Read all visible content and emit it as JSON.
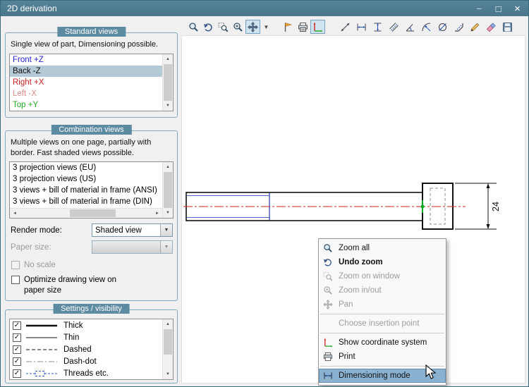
{
  "window": {
    "title": "2D derivation"
  },
  "standard_views": {
    "title": "Standard views",
    "description": "Single view of part, Dimensioning possible.",
    "items": [
      {
        "label": "Front +Z",
        "color": "#2222cc",
        "selected": false
      },
      {
        "label": "Back -Z",
        "color": "#111111",
        "selected": true
      },
      {
        "label": "Right +X",
        "color": "#cc2222",
        "selected": false
      },
      {
        "label": "Left -X",
        "color": "#dd8888",
        "selected": false
      },
      {
        "label": "Top +Y",
        "color": "#22aa22",
        "selected": false
      }
    ]
  },
  "combination_views": {
    "title": "Combination views",
    "description": "Multiple views on one page, partially with border. Fast shaded views possible.",
    "items": [
      "3 projection views (EU)",
      "3 projection views (US)",
      "3 views + bill of material in frame (ANSI)",
      "3 views + bill of material in frame (DIN)"
    ],
    "render_mode_label": "Render mode:",
    "render_mode_value": "Shaded view",
    "paper_size_label": "Paper size:",
    "no_scale_label": "No scale",
    "optimize_label": "Optimize drawing view on paper size"
  },
  "settings": {
    "title": "Settings / visibility",
    "items": [
      {
        "label": "Thick",
        "checked": true
      },
      {
        "label": "Thin",
        "checked": true
      },
      {
        "label": "Dashed",
        "checked": true
      },
      {
        "label": "Dash-dot",
        "checked": true
      },
      {
        "label": "Threads etc.",
        "checked": true
      }
    ]
  },
  "toolbar": {
    "view_tools": [
      "zoom-all",
      "undo-zoom",
      "zoom-on-window",
      "zoom-in-out",
      "pan",
      "view-options-dropdown",
      "choose-insertion-point",
      "print",
      "show-coordinate-system"
    ],
    "active_tools": [
      "pan",
      "show-coordinate-system"
    ],
    "dimension_tools": [
      "smart-dimension",
      "horizontal-dimension",
      "vertical-dimension",
      "parallel-dimension",
      "angle-dimension",
      "radius-dimension",
      "diameter-dimension",
      "chamfer-dimension",
      "edit-dimension",
      "delete-dimension",
      "save-drawing"
    ]
  },
  "drawing": {
    "dimension_label": "24",
    "centerline_color": "#cc2222",
    "highlight_color": "#00aa22",
    "thread_line_color": "#2233bb"
  },
  "context_menu": {
    "items": [
      {
        "label": "Zoom all",
        "enabled": true
      },
      {
        "label": "Undo zoom",
        "enabled": true,
        "bold": true
      },
      {
        "label": "Zoom on window",
        "enabled": false
      },
      {
        "label": "Zoom in/out",
        "enabled": false
      },
      {
        "label": "Pan",
        "enabled": false
      },
      {
        "label": "Choose insertion point",
        "enabled": false
      },
      {
        "label": "Show coordinate system",
        "enabled": true
      },
      {
        "label": "Print",
        "enabled": true
      },
      {
        "label": "Dimensioning mode",
        "enabled": true,
        "highlighted": true
      }
    ]
  },
  "colors": {
    "titlebar": "#4e7f95",
    "group_border": "#7fa8c0",
    "badge_bg": "#5d8ba1",
    "selection_bg": "#b6c9d6",
    "menu_highlight": "#8ab1cf"
  }
}
